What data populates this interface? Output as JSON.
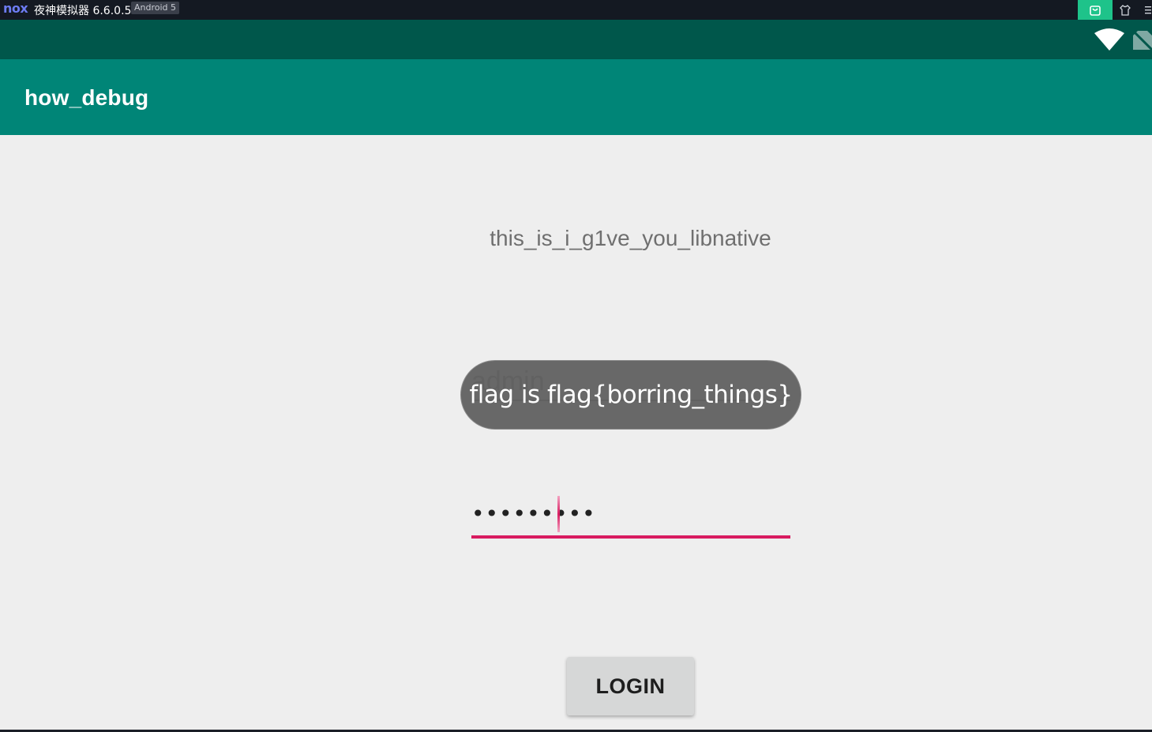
{
  "emulator": {
    "logo": "nox",
    "title": "夜神模拟器 6.6.0.5",
    "android_badge": "Android 5",
    "store_icon": "store-bag-icon",
    "skin_icon": "shirt-icon",
    "menu_icon": "menu-icon",
    "accent": "#1ec38a"
  },
  "statusbar": {
    "icons": [
      "wifi-icon",
      "no-sim-icon"
    ],
    "color": "#00574b"
  },
  "appbar": {
    "title": "how_debug",
    "color": "#008577"
  },
  "main": {
    "native_text": "this_is_i_g1ve_you_libnative",
    "username_value": "admin",
    "password_masked": "•••••••••",
    "login_label": "LOGIN",
    "accent": "#d81b60"
  },
  "toast": {
    "message": "flag is flag{borring_things}"
  }
}
